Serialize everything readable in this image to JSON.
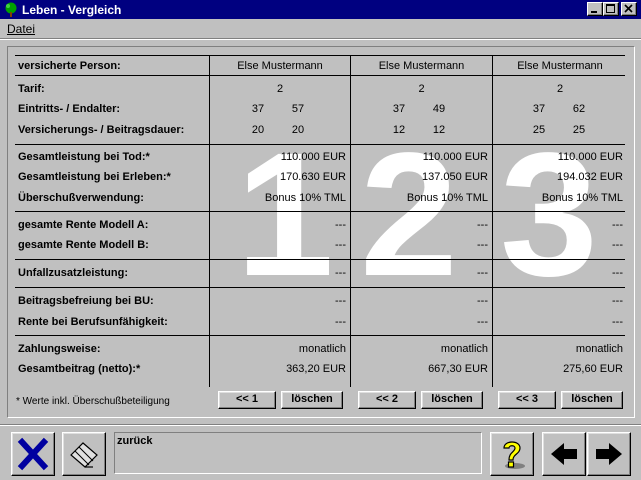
{
  "window": {
    "title": "Leben - Vergleich"
  },
  "menu": {
    "datei": "Datei"
  },
  "big_numbers": [
    "1",
    "2",
    "3"
  ],
  "labels": {
    "person": "versicherte Person:",
    "tarif": "Tarif:",
    "eintritt": "Eintritts- /  Endalter:",
    "dauer": "Versicherungs- / Beitragsdauer:",
    "tod": "Gesamtleistung bei Tod:*",
    "erleben": "Gesamtleistung bei Erleben:*",
    "ueberschuss": "Überschußverwendung:",
    "rente_a": "gesamte Rente Modell A:",
    "rente_b": "gesamte Rente Modell B:",
    "unfall": "Unfallzusatzleistung:",
    "beitragsbefreiung": "Beitragsbefreiung bei BU:",
    "rente_bu": "Rente bei Berufsunfähigkeit:",
    "zahlungsweise": "Zahlungsweise:",
    "gesamtbeitrag": "Gesamtbeitrag (netto):*"
  },
  "columns": [
    {
      "person": "Else Mustermann",
      "tarif": "2",
      "eintritt": "37",
      "endalter": "57",
      "versdauer": "20",
      "beitragsdauer": "20",
      "tod": "110.000 EUR",
      "erleben": "170.630 EUR",
      "ueberschuss": "Bonus 10% TML",
      "rente_a": "---",
      "rente_b": "---",
      "unfall": "---",
      "beitragsbefreiung": "---",
      "rente_bu": "---",
      "zahlungsweise": "monatlich",
      "gesamtbeitrag": "363,20 EUR",
      "nav_button": "<< 1",
      "delete_button": "löschen"
    },
    {
      "person": "Else Mustermann",
      "tarif": "2",
      "eintritt": "37",
      "endalter": "49",
      "versdauer": "12",
      "beitragsdauer": "12",
      "tod": "110.000 EUR",
      "erleben": "137.050 EUR",
      "ueberschuss": "Bonus 10% TML",
      "rente_a": "---",
      "rente_b": "---",
      "unfall": "---",
      "beitragsbefreiung": "---",
      "rente_bu": "---",
      "zahlungsweise": "monatlich",
      "gesamtbeitrag": "667,30 EUR",
      "nav_button": "<< 2",
      "delete_button": "löschen"
    },
    {
      "person": "Else Mustermann",
      "tarif": "2",
      "eintritt": "37",
      "endalter": "62",
      "versdauer": "25",
      "beitragsdauer": "25",
      "tod": "110.000 EUR",
      "erleben": "194.032 EUR",
      "ueberschuss": "Bonus 10% TML",
      "rente_a": "---",
      "rente_b": "---",
      "unfall": "---",
      "beitragsbefreiung": "---",
      "rente_bu": "---",
      "zahlungsweise": "monatlich",
      "gesamtbeitrag": "275,60 EUR",
      "nav_button": "<< 3",
      "delete_button": "löschen"
    }
  ],
  "footnote": "* Werte inkl. Überschußbeteiligung",
  "status": {
    "text": "zurück"
  },
  "icons": {
    "close": "x-close-icon",
    "tool": "eraser-icon",
    "help": "question-mark-icon",
    "back": "arrow-left-icon",
    "forward": "arrow-right-icon"
  },
  "colors": {
    "titlebar": "#000080",
    "face": "#c0c0c0",
    "close_x": "#0000a0",
    "help": "#ffff00"
  }
}
